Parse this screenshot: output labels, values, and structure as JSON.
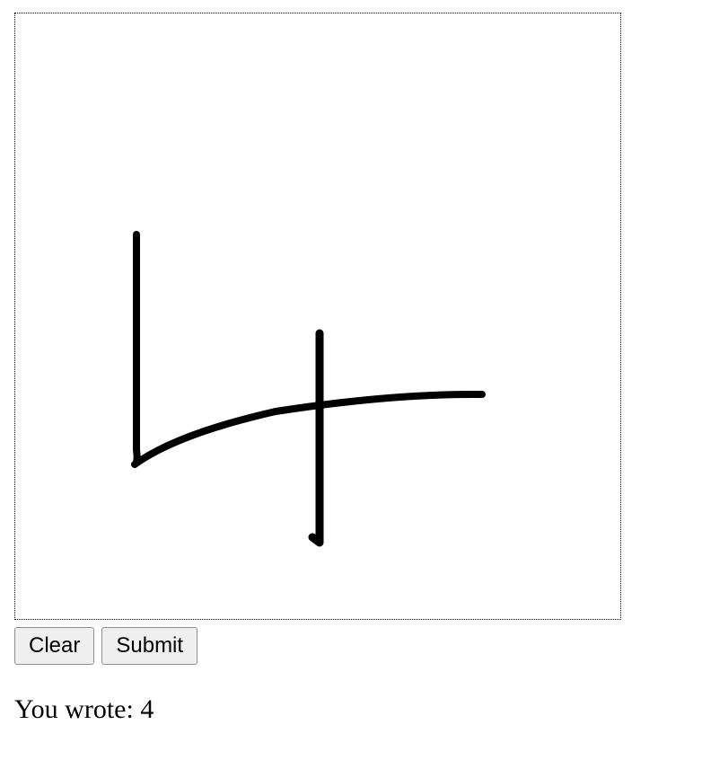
{
  "drawing_canvas": {
    "stroke_color": "#000000",
    "background_color": "#ffffff",
    "border_style": "dotted"
  },
  "buttons": {
    "clear_label": "Clear",
    "submit_label": "Submit"
  },
  "result": {
    "prefix": "You wrote:",
    "value": "4"
  }
}
